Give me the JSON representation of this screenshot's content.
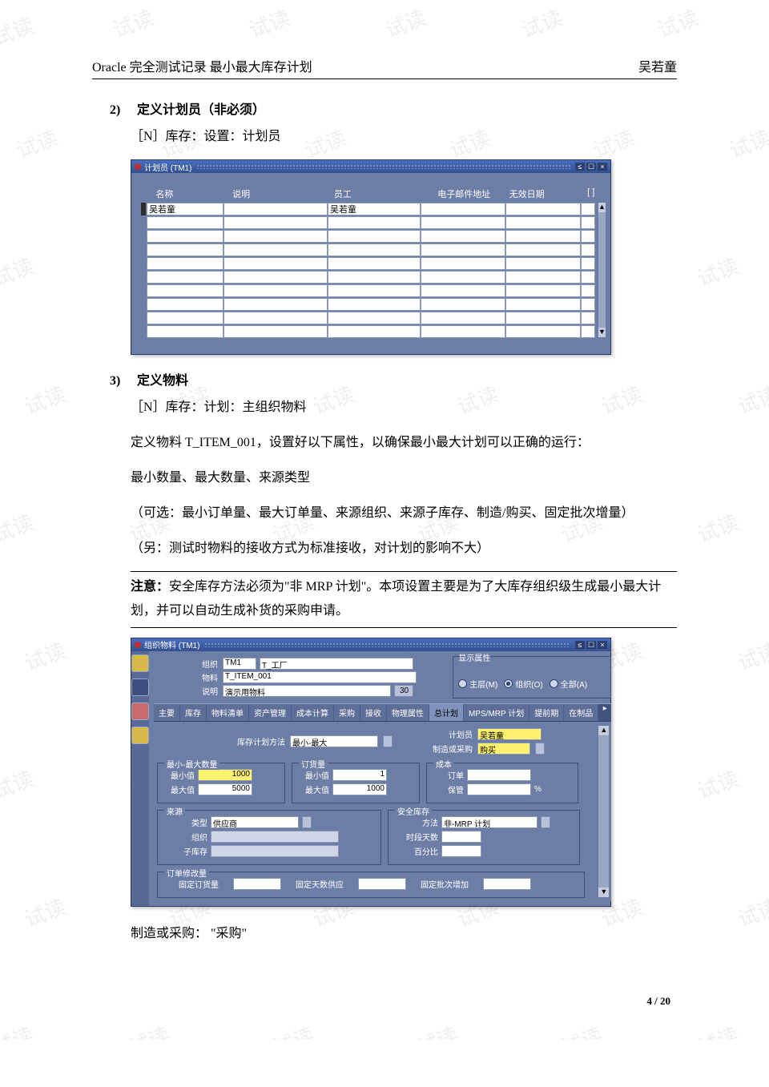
{
  "header": {
    "left": "Oracle 完全测试记录  最小最大库存计划",
    "right": "吴若童"
  },
  "section2": {
    "num": "2)",
    "title": "定义计划员（非必须）",
    "nav": "［N］库存：设置：计划员"
  },
  "planner_window": {
    "title": "计划员 (TM1)",
    "columns": {
      "name": "名称",
      "desc": "说明",
      "emp": "员工",
      "email": "电子邮件地址",
      "invalid": "无效日期",
      "flag": "[  ]"
    },
    "row1": {
      "name": "吴若童",
      "desc": "",
      "emp": "吴若童",
      "email": "",
      "invalid": ""
    }
  },
  "section3": {
    "num": "3)",
    "title": "定义物料",
    "nav": "［N］库存：计划：主组织物料",
    "p1": "定义物料 T_ITEM_001，设置好以下属性，以确保最小最大计划可以正确的运行：",
    "p2": "最小数量、最大数量、来源类型",
    "p3": "（可选：最小订单量、最大订单量、来源组织、来源子库存、制造/购买、固定批次增量）",
    "p4": "（另：测试时物料的接收方式为标准接收，对计划的影响不大）",
    "note_label": "注意：",
    "note_text": "安全库存方法必须为\"非 MRP 计划\"。本项设置主要是为了大库存组织级生成最小最大计划，并可以自动生成补货的采购申请。"
  },
  "item_window": {
    "title": "组织物料 (TM1)",
    "hdr": {
      "org_lbl": "组织",
      "org_code": "TM1",
      "org_name": "T_工厂",
      "item_lbl": "物料",
      "item": "T_ITEM_001",
      "desc_lbl": "说明",
      "desc": "演示用物料",
      "btn": "30",
      "disp_group_title": "显示属性",
      "disp_master": "主层(M)",
      "disp_org": "组织(O)",
      "disp_all": "全部(A)"
    },
    "tabs": [
      "主要",
      "库存",
      "物料清单",
      "资产管理",
      "成本计算",
      "采购",
      "接收",
      "物理属性",
      "总计划",
      "MPS/MRP 计划",
      "提前期",
      "在制品"
    ],
    "active_tab": "总计划",
    "panel": {
      "plan_method_lbl": "库存计划方法",
      "plan_method": "最小-最大",
      "planner_lbl": "计划员",
      "planner": "吴若童",
      "makebuy_lbl": "制造或采购",
      "makebuy": "购买",
      "g_minmax": {
        "title": "最小-最大数量",
        "min_lbl": "最小值",
        "min": "1000",
        "max_lbl": "最大值",
        "max": "5000"
      },
      "g_order": {
        "title": "订货量",
        "min_lbl": "最小值",
        "min": "1",
        "max_lbl": "最大值",
        "max": "1000"
      },
      "g_cost": {
        "title": "成本",
        "order_lbl": "订单",
        "order": "",
        "carry_lbl": "保管",
        "carry": "",
        "pct": "%"
      },
      "g_source": {
        "title": "来源",
        "type_lbl": "类型",
        "type": "供应商",
        "org_lbl": "组织",
        "org": "",
        "sub_lbl": "子库存",
        "sub": ""
      },
      "g_safe": {
        "title": "安全库存",
        "method_lbl": "方法",
        "method": "非-MRP 计划",
        "days_lbl": "时段天数",
        "days": "",
        "pct_lbl": "百分比",
        "pct": ""
      },
      "g_ordmod": {
        "title": "订单修改量",
        "fixed_qty_lbl": "固定订货量",
        "fixed_qty": "",
        "fixed_days_lbl": "固定天数供应",
        "fixed_days": "",
        "fixed_lot_lbl": "固定批次增加",
        "fixed_lot": ""
      }
    }
  },
  "tail_text": "制造或采购：  \"采购\"",
  "footer": "4 / 20",
  "wm": "试读"
}
